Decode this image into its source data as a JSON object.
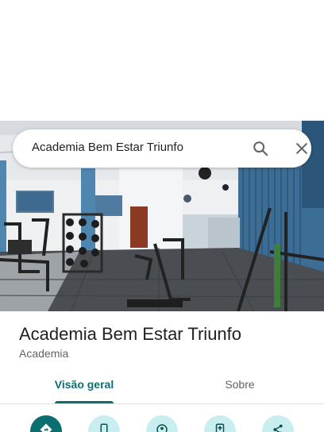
{
  "search": {
    "query": "Academia Bem Estar Triunfo"
  },
  "place": {
    "name": "Academia Bem Estar Triunfo",
    "category": "Academia"
  },
  "tabs": [
    {
      "label": "Visão geral",
      "active": true
    },
    {
      "label": "Sobre",
      "active": false
    }
  ],
  "actions": [
    {
      "icon": "directions-icon"
    },
    {
      "icon": "phone-icon"
    },
    {
      "icon": "save-icon"
    },
    {
      "icon": "share-to-phone-icon"
    },
    {
      "icon": "share-icon"
    }
  ],
  "colors": {
    "accent": "#0b6e70",
    "action_bg": "#c9eef0"
  }
}
